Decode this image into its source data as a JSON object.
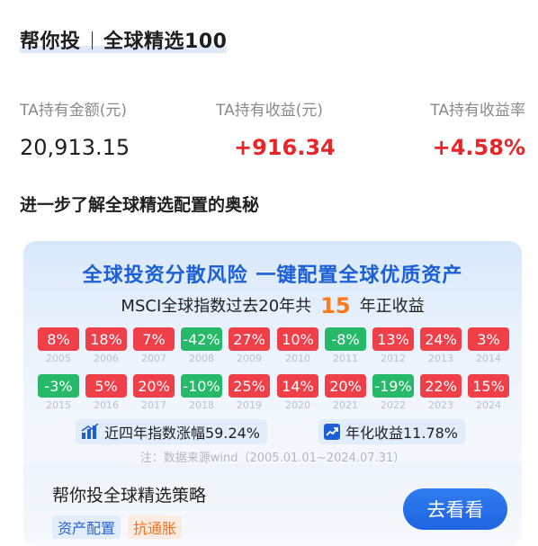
{
  "header": {
    "prefix": "帮你投",
    "product": "全球精选100"
  },
  "stats": [
    {
      "label": "TA持有金额(元)",
      "value": "20,913.15",
      "color": "black"
    },
    {
      "label": "TA持有收益(元)",
      "value": "+916.34",
      "color": "red"
    },
    {
      "label": "TA持有收益率",
      "value": "+4.58%",
      "color": "red"
    }
  ],
  "subtitle": "进一步了解全球精选配置的奥秘",
  "banner": {
    "headline": "全球投资分散风险  一键配置全球优质资产",
    "sub_before": "MSCI全球指数过去20年共",
    "sub_count": "15",
    "sub_after": "年正收益",
    "row1": [
      {
        "value": "8%",
        "year": "2005",
        "type": "pos"
      },
      {
        "value": "18%",
        "year": "2006",
        "type": "pos"
      },
      {
        "value": "7%",
        "year": "2007",
        "type": "pos"
      },
      {
        "value": "-42%",
        "year": "2008",
        "type": "neg"
      },
      {
        "value": "27%",
        "year": "2009",
        "type": "pos"
      },
      {
        "value": "10%",
        "year": "2010",
        "type": "pos"
      },
      {
        "value": "-8%",
        "year": "2011",
        "type": "neg"
      },
      {
        "value": "13%",
        "year": "2012",
        "type": "pos"
      },
      {
        "value": "24%",
        "year": "2013",
        "type": "pos"
      },
      {
        "value": "3%",
        "year": "2014",
        "type": "pos"
      }
    ],
    "row2": [
      {
        "value": "-3%",
        "year": "2015",
        "type": "neg"
      },
      {
        "value": "5%",
        "year": "2016",
        "type": "pos"
      },
      {
        "value": "20%",
        "year": "2017",
        "type": "pos"
      },
      {
        "value": "-10%",
        "year": "2018",
        "type": "neg"
      },
      {
        "value": "25%",
        "year": "2019",
        "type": "pos"
      },
      {
        "value": "14%",
        "year": "2020",
        "type": "pos"
      },
      {
        "value": "20%",
        "year": "2021",
        "type": "pos"
      },
      {
        "value": "-19%",
        "year": "2022",
        "type": "neg"
      },
      {
        "value": "22%",
        "year": "2023",
        "type": "pos"
      },
      {
        "value": "15%",
        "year": "2024",
        "type": "pos"
      }
    ],
    "badge_growth": "近四年指数涨幅59.24%",
    "badge_annual": "年化收益11.78%",
    "note": "注：数据来源wind（2005.01.01~2024.07.31）"
  },
  "strategy": {
    "title": "帮你投全球精选策略",
    "tags": [
      "资产配置",
      "抗通胀"
    ],
    "button": "去看看"
  },
  "colors": {
    "accent_blue": "#1c5fd6",
    "positive_red": "#ef3f49",
    "negative_green": "#26b96a",
    "highlight_orange": "#ff7a1a",
    "value_red": "#e8262a"
  },
  "icons": [
    "bar-chart-icon",
    "trend-up-icon"
  ]
}
